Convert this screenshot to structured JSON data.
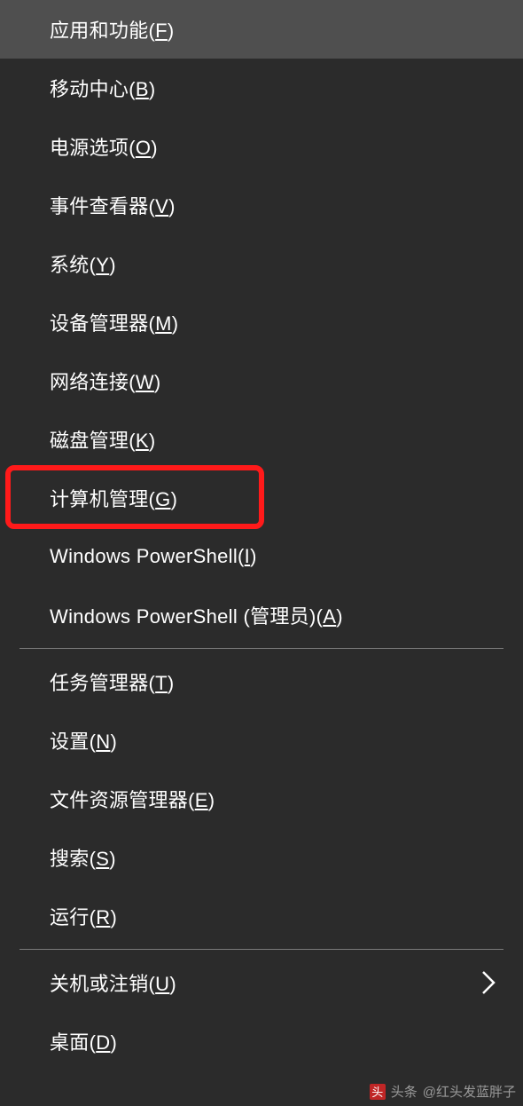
{
  "menu": {
    "groups": [
      [
        {
          "prefix": "应用和功能(",
          "acc": "F",
          "suffix": ")",
          "highlight": true,
          "name": "menu-apps-features",
          "submenu": false,
          "boxed": false
        },
        {
          "prefix": "移动中心(",
          "acc": "B",
          "suffix": ")",
          "highlight": false,
          "name": "menu-mobility-center",
          "submenu": false,
          "boxed": false
        },
        {
          "prefix": "电源选项(",
          "acc": "O",
          "suffix": ")",
          "highlight": false,
          "name": "menu-power-options",
          "submenu": false,
          "boxed": false
        },
        {
          "prefix": "事件查看器(",
          "acc": "V",
          "suffix": ")",
          "highlight": false,
          "name": "menu-event-viewer",
          "submenu": false,
          "boxed": false
        },
        {
          "prefix": "系统(",
          "acc": "Y",
          "suffix": ")",
          "highlight": false,
          "name": "menu-system",
          "submenu": false,
          "boxed": false
        },
        {
          "prefix": "设备管理器(",
          "acc": "M",
          "suffix": ")",
          "highlight": false,
          "name": "menu-device-manager",
          "submenu": false,
          "boxed": false
        },
        {
          "prefix": "网络连接(",
          "acc": "W",
          "suffix": ")",
          "highlight": false,
          "name": "menu-network-connections",
          "submenu": false,
          "boxed": false
        },
        {
          "prefix": "磁盘管理(",
          "acc": "K",
          "suffix": ")",
          "highlight": false,
          "name": "menu-disk-management",
          "submenu": false,
          "boxed": false
        },
        {
          "prefix": "计算机管理(",
          "acc": "G",
          "suffix": ")",
          "highlight": false,
          "name": "menu-computer-management",
          "submenu": false,
          "boxed": true
        },
        {
          "prefix": "Windows PowerShell(",
          "acc": "I",
          "suffix": ")",
          "highlight": false,
          "name": "menu-powershell",
          "submenu": false,
          "boxed": false
        },
        {
          "prefix": "Windows PowerShell (管理员)(",
          "acc": "A",
          "suffix": ")",
          "highlight": false,
          "name": "menu-powershell-admin",
          "submenu": false,
          "boxed": false
        }
      ],
      [
        {
          "prefix": "任务管理器(",
          "acc": "T",
          "suffix": ")",
          "highlight": false,
          "name": "menu-task-manager",
          "submenu": false,
          "boxed": false
        },
        {
          "prefix": "设置(",
          "acc": "N",
          "suffix": ")",
          "highlight": false,
          "name": "menu-settings",
          "submenu": false,
          "boxed": false
        },
        {
          "prefix": "文件资源管理器(",
          "acc": "E",
          "suffix": ")",
          "highlight": false,
          "name": "menu-file-explorer",
          "submenu": false,
          "boxed": false
        },
        {
          "prefix": "搜索(",
          "acc": "S",
          "suffix": ")",
          "highlight": false,
          "name": "menu-search",
          "submenu": false,
          "boxed": false
        },
        {
          "prefix": "运行(",
          "acc": "R",
          "suffix": ")",
          "highlight": false,
          "name": "menu-run",
          "submenu": false,
          "boxed": false
        }
      ],
      [
        {
          "prefix": "关机或注销(",
          "acc": "U",
          "suffix": ")",
          "highlight": false,
          "name": "menu-shutdown-signout",
          "submenu": true,
          "boxed": false
        },
        {
          "prefix": "桌面(",
          "acc": "D",
          "suffix": ")",
          "highlight": false,
          "name": "menu-desktop",
          "submenu": false,
          "boxed": false
        }
      ]
    ]
  },
  "annotation": {
    "highlight_color": "#ff1a1a"
  },
  "watermark": {
    "prefix": "头条",
    "author": "@红头发蓝胖子"
  }
}
